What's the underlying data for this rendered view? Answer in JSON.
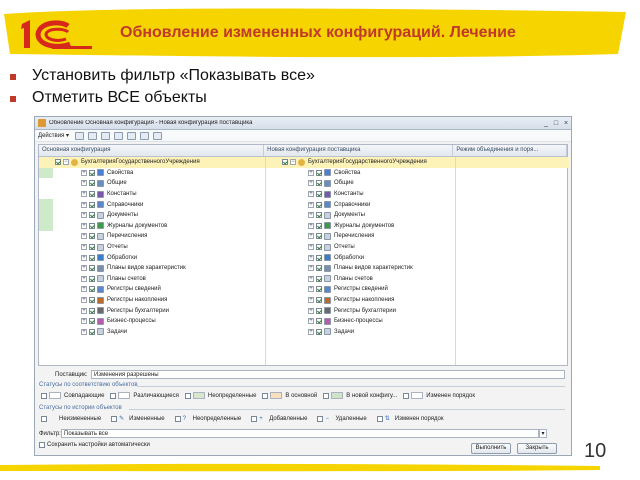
{
  "slide": {
    "title": "Обновление измененных конфигураций. Лечение",
    "bullets": [
      "Установить фильтр «Показывать все»",
      "Отметить ВСЕ объекты"
    ],
    "page_number": "10",
    "colors": {
      "accent": "#c0392b",
      "highlight": "#f5d400",
      "logo_red": "#d7281c"
    }
  },
  "window": {
    "title": "Обновление Основная конфигурация - Новая конфигурация поставщика",
    "controls": [
      "_",
      "□",
      "×"
    ],
    "toolbar": {
      "actions_label": "Действия ▾"
    },
    "columns": [
      "Основная конфигурация",
      "Новая конфигурация поставщика",
      "Режим объединения и поря..."
    ],
    "root_label": "БухгалтерияГосударственногоУчреждения",
    "tree_items": [
      {
        "label": "Свойства",
        "icon_color": "#4a7fd4"
      },
      {
        "label": "Общие",
        "icon_color": "#6a8fbf"
      },
      {
        "label": "Константы",
        "icon_color": "#7a5aa8"
      },
      {
        "label": "Справочники",
        "icon_color": "#5a88c8"
      },
      {
        "label": "Документы",
        "icon_color": "#c8d2de"
      },
      {
        "label": "Журналы документов",
        "icon_color": "#3e9a4a"
      },
      {
        "label": "Перечисления",
        "icon_color": "#c8d2de"
      },
      {
        "label": "Отчеты",
        "icon_color": "#c8d2de"
      },
      {
        "label": "Обработки",
        "icon_color": "#3a7ec8"
      },
      {
        "label": "Планы видов характеристик",
        "icon_color": "#7a8fa8"
      },
      {
        "label": "Планы счетов",
        "icon_color": "#c8d2de"
      },
      {
        "label": "Регистры сведений",
        "icon_color": "#5a88c8"
      },
      {
        "label": "Регистры накопления",
        "icon_color": "#c06a2a"
      },
      {
        "label": "Регистры бухгалтерии",
        "icon_color": "#6a6a6a"
      },
      {
        "label": "Бизнес-процессы",
        "icon_color": "#b85ab0"
      },
      {
        "label": "Задачи",
        "icon_color": "#c8d2de"
      }
    ],
    "vendor": {
      "label": "Поставщик:",
      "value": "Изменения разрешены"
    },
    "statuses_match": {
      "title": "Статусы по соответствию объектов",
      "items": [
        {
          "label": "Совпадающие",
          "color": "#ffffff"
        },
        {
          "label": "Различающиеся",
          "color": "#ffffff"
        },
        {
          "label": "Неопределенные",
          "color": "#d8e6d0"
        },
        {
          "label": "В основной",
          "color": "#f7dfc0"
        },
        {
          "label": "В новой конфигу...",
          "color": "#cfe3c8"
        },
        {
          "label": "Изменен порядок",
          "color": "#ffffff"
        }
      ]
    },
    "statuses_history": {
      "title": "Статусы по истории объектов",
      "items": [
        {
          "label": "Неизмененные",
          "icon": "none"
        },
        {
          "label": "Измененные",
          "icon": "pencil-icon"
        },
        {
          "label": "Неопределенные",
          "icon": "question-icon"
        },
        {
          "label": "Добавленные",
          "icon": "plus-icon"
        },
        {
          "label": "Удаленные",
          "icon": "minus-icon"
        },
        {
          "label": "Изменен порядок",
          "icon": "sort-icon"
        }
      ]
    },
    "filter": {
      "label": "Фильтр:",
      "value": "Показывать все"
    },
    "save_settings_label": "Сохранить настройки автоматически",
    "buttons": {
      "run": "Выполнить",
      "close": "Закрыть"
    }
  }
}
